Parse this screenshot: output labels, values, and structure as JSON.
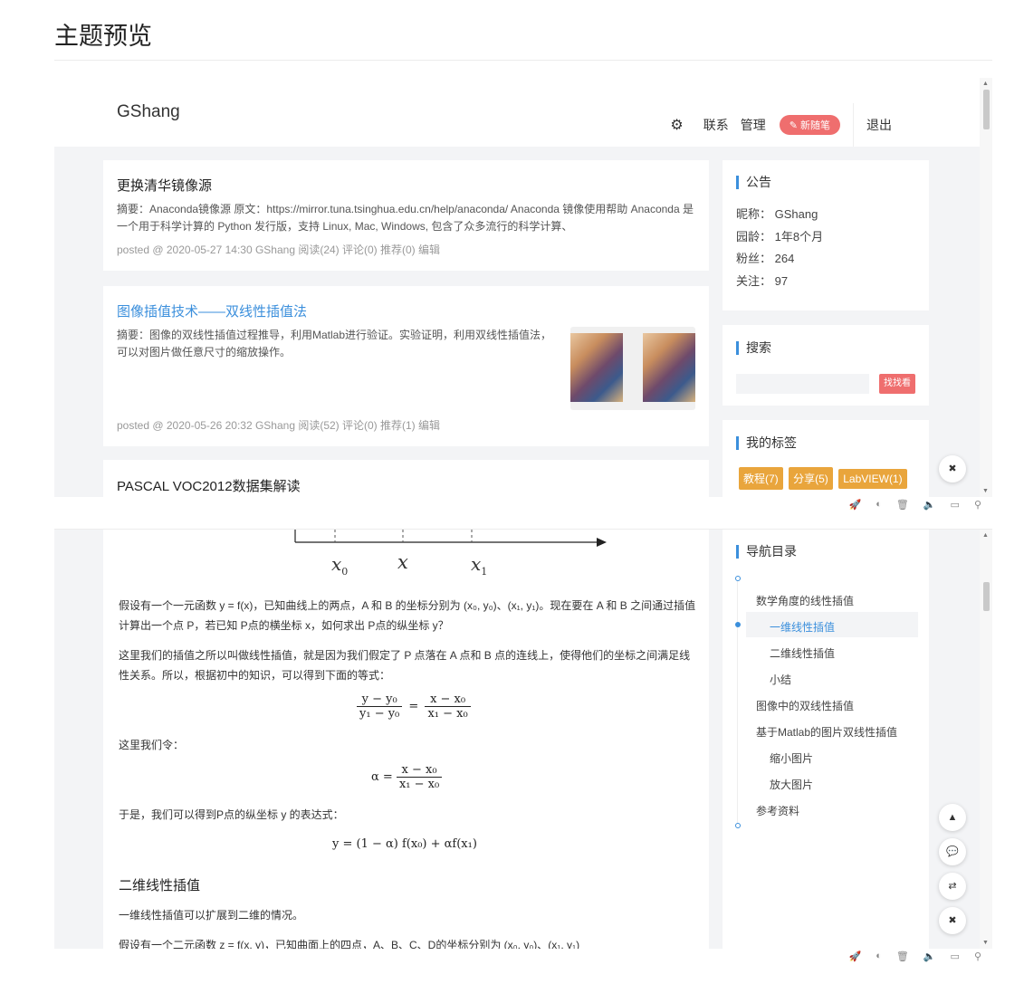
{
  "page_title": "主题预览",
  "preview1": {
    "nav": {
      "brand": "GShang",
      "links": [
        "联系",
        "管理"
      ],
      "new_post": "✎ 新随笔",
      "logout": "退出"
    },
    "posts": [
      {
        "title": "更换清华镜像源",
        "abstract": "摘要：Anaconda镜像源 原文：https://mirror.tuna.tsinghua.edu.cn/help/anaconda/ Anaconda 镜像使用帮助 Anaconda 是一个用于科学计算的 Python 发行版，支持 Linux, Mac, Windows, 包含了众多流行的科学计算、",
        "meta": "posted @ 2020-05-27 14:30 GShang 阅读(24) 评论(0) 推荐(0) 编辑"
      },
      {
        "title": "图像插值技术——双线性插值法",
        "abstract": "摘要：图像的双线性插值过程推导，利用Matlab进行验证。实验证明，利用双线性插值法，可以对图片做任意尺寸的缩放操作。",
        "meta": "posted @ 2020-05-26 20:32 GShang 阅读(52) 评论(0) 推荐(1) 编辑"
      },
      {
        "title": "PASCAL VOC2012数据集解读"
      }
    ],
    "notice": {
      "heading": "公告",
      "nickname": "昵称：  GShang",
      "age": "园龄：  1年8个月",
      "fans": "粉丝：  264",
      "follow": "关注：  97"
    },
    "search": {
      "heading": "搜索",
      "placeholder": "",
      "button": "找找看"
    },
    "tags": {
      "heading": "我的标签",
      "items": [
        "教程(7)",
        "分享(5)",
        "LabVIEW(1)"
      ]
    }
  },
  "preview2": {
    "figure": {
      "x0": "x",
      "x0_sub": "0",
      "x": "x",
      "x1": "x",
      "x1_sub": "1"
    },
    "para1": "假设有一个一元函数 y = f(x)，已知曲线上的两点，A 和 B 的坐标分别为 (x₀, y₀)、(x₁, y₁)。现在要在 A 和 B 之间通过插值计算出一个点 P，若已知 P点的横坐标 x，如何求出 P点的纵坐标 y？",
    "para2": "这里我们的插值之所以叫做线性插值，就是因为我们假定了 P 点落在 A 点和 B 点的连线上，使得他们的坐标之间满足线性关系。所以，根据初中的知识，可以得到下面的等式：",
    "eq1_lhs_num": "y − y₀",
    "eq1_lhs_den": "y₁ − y₀",
    "eq1_rhs_num": "x − x₀",
    "eq1_rhs_den": "x₁ − x₀",
    "para3": "这里我们令：",
    "eq2_lhs": "α =",
    "eq2_num": "x − x₀",
    "eq2_den": "x₁ − x₀",
    "para4": "于是，我们可以得到P点的纵坐标 y 的表达式：",
    "eq3": "y = (1 − α) f(x₀) + αf(x₁)",
    "heading2": "二维线性插值",
    "para5": "一维线性插值可以扩展到二维的情况。",
    "para6": "假设有一个二元函数 z = f(x, y)，已知曲面上的四点，A、B、C、D的坐标分别为 (x₀, y₀)、(x₁, y₁)",
    "toc": {
      "heading": "导航目录",
      "items": [
        "数学角度的线性插值",
        "一维线性插值",
        "二维线性插值",
        "小结",
        "图像中的双线性插值",
        "基于Matlab的图片双线性插值",
        "缩小图片",
        "放大图片",
        "参考资料"
      ]
    }
  },
  "colors": {
    "accent": "#3b8fdc",
    "new_button": "#ef6e6e",
    "tag": "#e9a53c"
  },
  "toolbar_icons": [
    "rocket-icon",
    "palette-icon",
    "trash-icon",
    "sound-icon",
    "window-icon",
    "search-icon"
  ]
}
